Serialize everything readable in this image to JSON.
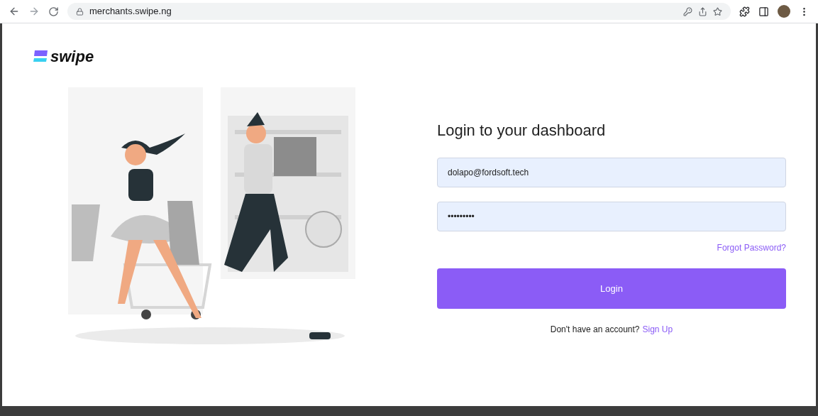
{
  "browser": {
    "url": "merchants.swipe.ng"
  },
  "logo": {
    "text": "swipe"
  },
  "login": {
    "title": "Login to your dashboard",
    "email": {
      "value": "dolapo@fordsoft.tech"
    },
    "password": {
      "value": "•••••••••"
    },
    "forgot": "Forgot Password?",
    "button": "Login",
    "signup_prompt": "Don't have an account?",
    "signup_link": "Sign Up"
  }
}
